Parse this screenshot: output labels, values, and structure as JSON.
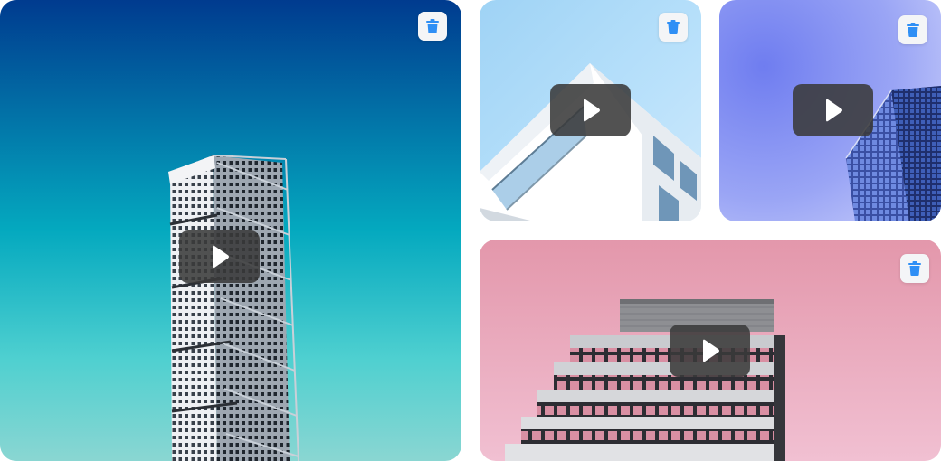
{
  "gallery": {
    "items": [
      {
        "id": "tile-1",
        "media": "video",
        "subject": "twisting-tower-teal-sky"
      },
      {
        "id": "tile-2",
        "media": "video",
        "subject": "white-building-corner-blue-sky"
      },
      {
        "id": "tile-3",
        "media": "video",
        "subject": "glass-skyscraper-lavender-sky"
      },
      {
        "id": "tile-4",
        "media": "video",
        "subject": "stepped-building-pink-sky"
      }
    ],
    "icons": {
      "delete": "trash-icon",
      "play": "play-icon"
    },
    "colors": {
      "delete_icon": "#2f8ff5",
      "delete_button_bg": "#f4f5f7",
      "play_button_bg": "#3a3a3a",
      "play_icon": "#ffffff"
    }
  }
}
